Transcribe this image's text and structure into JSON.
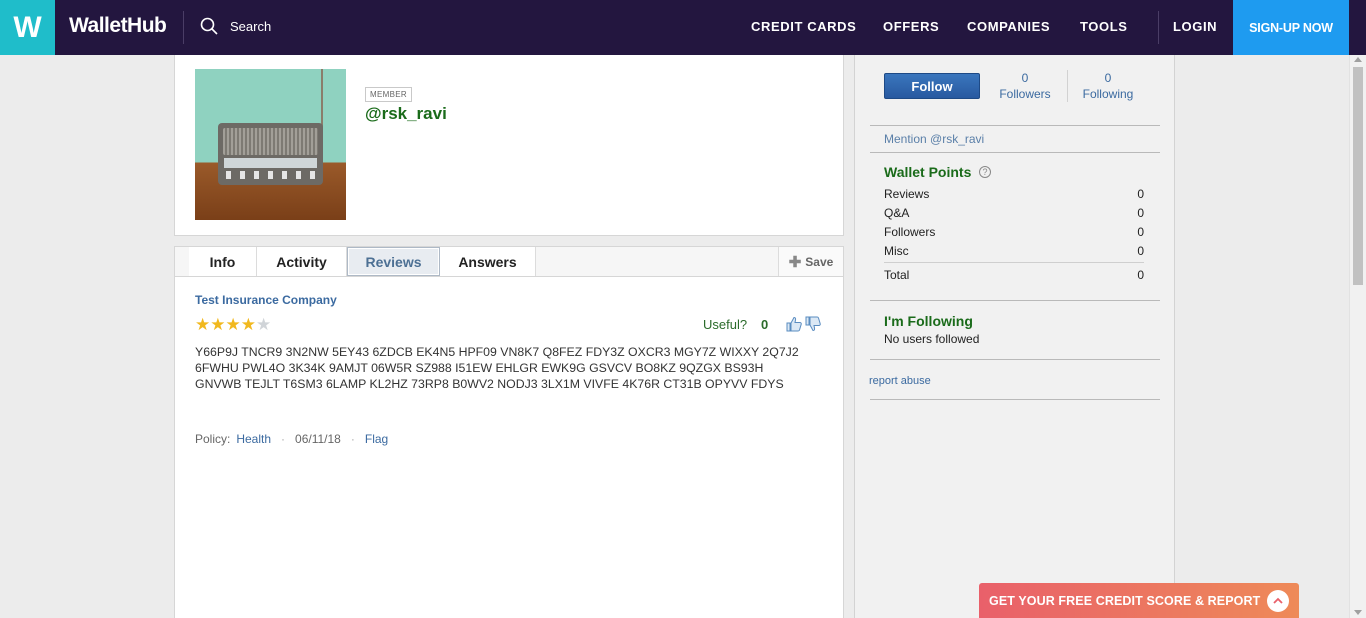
{
  "header": {
    "logo_letter": "W",
    "brand": "WalletHub",
    "search_placeholder": "Search",
    "nav": [
      "CREDIT CARDS",
      "OFFERS",
      "COMPANIES",
      "TOOLS"
    ],
    "login": "LOGIN",
    "signup": "SIGN-UP NOW",
    "colors": {
      "bar": "#23163f",
      "logo": "#1fbdca",
      "signup": "#1e9bf0"
    }
  },
  "profile": {
    "badge": "MEMBER",
    "username": "@rsk_ravi",
    "avatar_icon": "vintage-radio-image"
  },
  "tabs": {
    "items": [
      "Info",
      "Activity",
      "Reviews",
      "Answers"
    ],
    "active": "Reviews",
    "save_label": "Save"
  },
  "review": {
    "company": "Test Insurance Company",
    "rating": 4,
    "rating_max": 5,
    "useful_label": "Useful?",
    "useful_count": "0",
    "text": "Y66P9J TNCR9 3N2NW 5EY43 6ZDCB EK4N5 HPF09 VN8K7 Q8FEZ FDY3Z OXCR3 MGY7Z WIXXY 2Q7J2 6FWHU PWL4O 3K34K 9AMJT 06W5R SZ988 I51EW EHLGR EWK9G GSVCV BO8KZ 9QZGX BS93H GNVWB TEJLT T6SM3 6LAMP KL2HZ 73RP8 B0WV2 NODJ3 3LX1M VIVFE 4K76R CT31B OPYVV FDYS",
    "policy_label": "Policy:",
    "policy_value": "Health",
    "date": "06/11/18",
    "flag": "Flag"
  },
  "sidebar": {
    "follow_label": "Follow",
    "followers_count": "0",
    "followers_label": "Followers",
    "following_count": "0",
    "following_label": "Following",
    "mention": "Mention @rsk_ravi",
    "wallet_points_title": "Wallet Points",
    "points": [
      {
        "label": "Reviews",
        "value": "0"
      },
      {
        "label": "Q&A",
        "value": "0"
      },
      {
        "label": "Followers",
        "value": "0"
      },
      {
        "label": "Misc",
        "value": "0"
      }
    ],
    "total_label": "Total",
    "total_value": "0",
    "following_title": "I'm Following",
    "no_users": "No users followed",
    "report": "report abuse"
  },
  "cta": {
    "label": "GET YOUR FREE CREDIT SCORE & REPORT"
  }
}
